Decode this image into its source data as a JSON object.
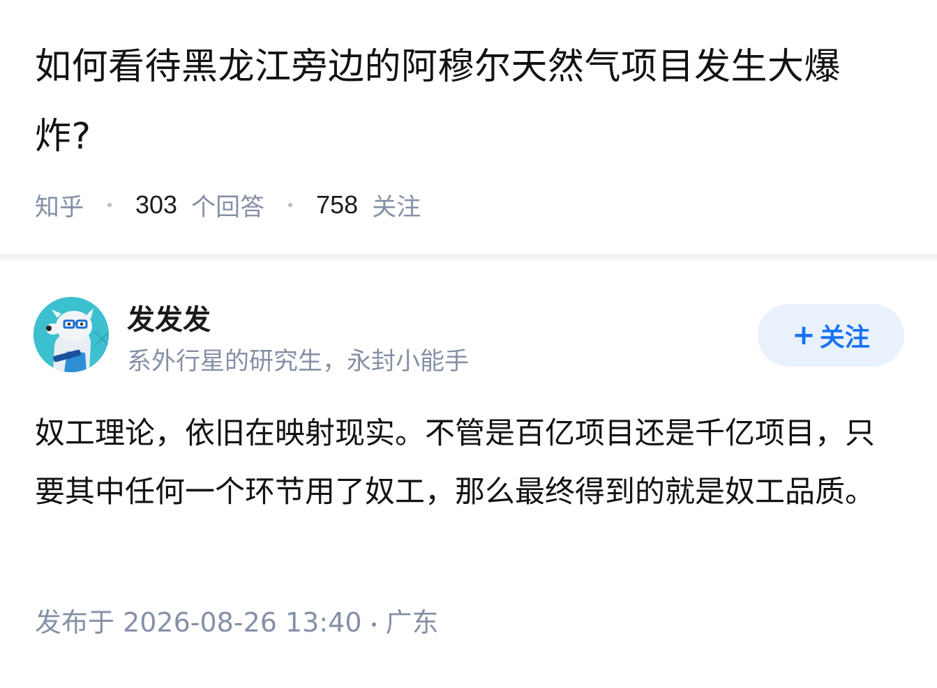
{
  "question": {
    "title": "如何看待黑龙江旁边的阿穆尔天然气项目发生大爆炸?",
    "source": "知乎",
    "answer_count": "303",
    "answer_count_label": "个回答",
    "follower_count": "758",
    "follower_count_label": "关注"
  },
  "answer": {
    "author": {
      "name": "发发发",
      "headline": "系外行星的研究生，永封小能手",
      "avatar_icon": "cartoon-dog-avatar"
    },
    "follow_button": {
      "icon": "plus-icon",
      "label": "关注"
    },
    "content": "奴工理论，依旧在映射现实。不管是百亿项目还是千亿项目，只要其中任何一个环节用了奴工，那么最终得到的就是奴工品质。",
    "published": "发布于 2026-08-26  13:40",
    "location": "广东"
  },
  "colors": {
    "accent": "#1772f6",
    "follow_bg": "#e9f1fc",
    "meta_gray": "#8590a6",
    "avatar_bg": "#3cc0cf"
  }
}
